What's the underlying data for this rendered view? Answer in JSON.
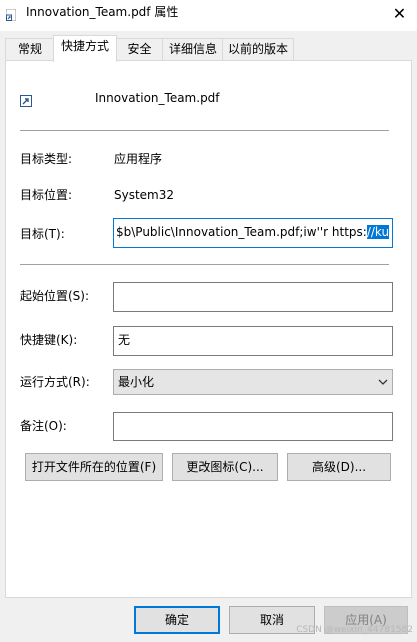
{
  "window": {
    "title": "Innovation_Team.pdf 属性",
    "close_glyph": "✕"
  },
  "tabs": [
    {
      "label": "常规"
    },
    {
      "label": "快捷方式"
    },
    {
      "label": "安全"
    },
    {
      "label": "详细信息"
    },
    {
      "label": "以前的版本"
    }
  ],
  "file": {
    "name": "Innovation_Team.pdf",
    "icon": "shortcut-file-icon"
  },
  "fields": {
    "target_type_label": "目标类型:",
    "target_type_value": "应用程序",
    "target_location_label": "目标位置:",
    "target_location_value": "System32",
    "target_label": "目标(T):",
    "target_value_plain": " $b\\Public\\Innovation_Team.pdf;iw''r https:",
    "target_value_selected": "//ku",
    "start_in_label": "起始位置(S):",
    "start_in_value": "",
    "shortcut_key_label": "快捷键(K):",
    "shortcut_key_value": "无",
    "run_label": "运行方式(R):",
    "run_value": "最小化",
    "comment_label": "备注(O):",
    "comment_value": ""
  },
  "buttons": {
    "open_location": "打开文件所在的位置(F)",
    "change_icon": "更改图标(C)...",
    "advanced": "高级(D)...",
    "ok": "确定",
    "cancel": "取消",
    "apply": "应用(A)"
  },
  "watermark": "CSDN @weixin_44781582",
  "colors": {
    "accent": "#0078d7",
    "window_bg": "#f0f0f0",
    "panel_bg": "#ffffff"
  }
}
